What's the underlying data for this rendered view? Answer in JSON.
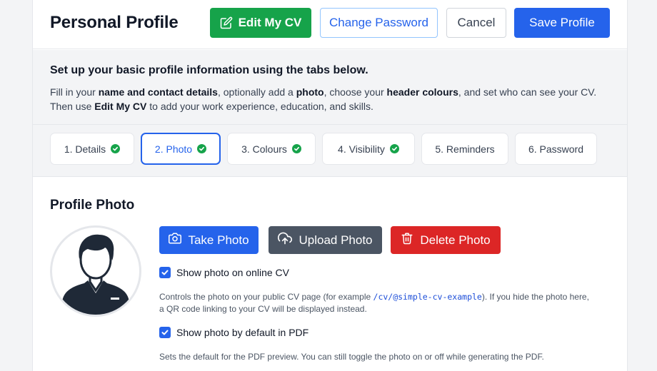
{
  "header": {
    "title": "Personal Profile",
    "edit_cv_label": "Edit My CV",
    "change_password_label": "Change Password",
    "cancel_label": "Cancel",
    "save_label": "Save Profile"
  },
  "intro": {
    "title": "Set up your basic profile information using the tabs below.",
    "desc_parts": [
      {
        "text": "Fill in your ",
        "bold": false
      },
      {
        "text": "name and contact details",
        "bold": true
      },
      {
        "text": ", optionally add a ",
        "bold": false
      },
      {
        "text": "photo",
        "bold": true
      },
      {
        "text": ", choose your ",
        "bold": false
      },
      {
        "text": "header colours",
        "bold": true
      },
      {
        "text": ", and set who can see your CV. Then use ",
        "bold": false
      },
      {
        "text": "Edit My CV",
        "bold": true
      },
      {
        "text": " to add your work experience, education, and skills.",
        "bold": false
      }
    ]
  },
  "tabs": [
    {
      "label": "1. Details",
      "complete": true,
      "active": false
    },
    {
      "label": "2. Photo",
      "complete": true,
      "active": true
    },
    {
      "label": "3. Colours",
      "complete": true,
      "active": false
    },
    {
      "label": "4. Visibility",
      "complete": true,
      "active": false
    },
    {
      "label": "5. Reminders",
      "complete": false,
      "active": false
    },
    {
      "label": "6. Password",
      "complete": false,
      "active": false
    }
  ],
  "photo": {
    "section_title": "Profile Photo",
    "take_label": "Take Photo",
    "upload_label": "Upload Photo",
    "delete_label": "Delete Photo",
    "show_online_label": "Show photo on online CV",
    "show_online_checked": true,
    "show_online_help_before": "Controls the photo on your public CV page (for example ",
    "show_online_help_code": "/cv/@simple-cv-example",
    "show_online_help_after": "). If you hide the photo here, a QR code linking to your CV will be displayed instead.",
    "show_pdf_label": "Show photo by default in PDF",
    "show_pdf_checked": true,
    "show_pdf_help": "Sets the default for the PDF preview. You can still toggle the photo on or off while generating the PDF."
  },
  "colors": {
    "primary": "#2563eb",
    "success": "#16a34a",
    "danger": "#dc2626",
    "neutral": "#4b5563"
  },
  "icons": {
    "edit": "edit-icon",
    "camera": "camera-icon",
    "upload": "cloud-upload-icon",
    "delete": "trash-icon",
    "tab_complete": "check-circle-icon"
  }
}
